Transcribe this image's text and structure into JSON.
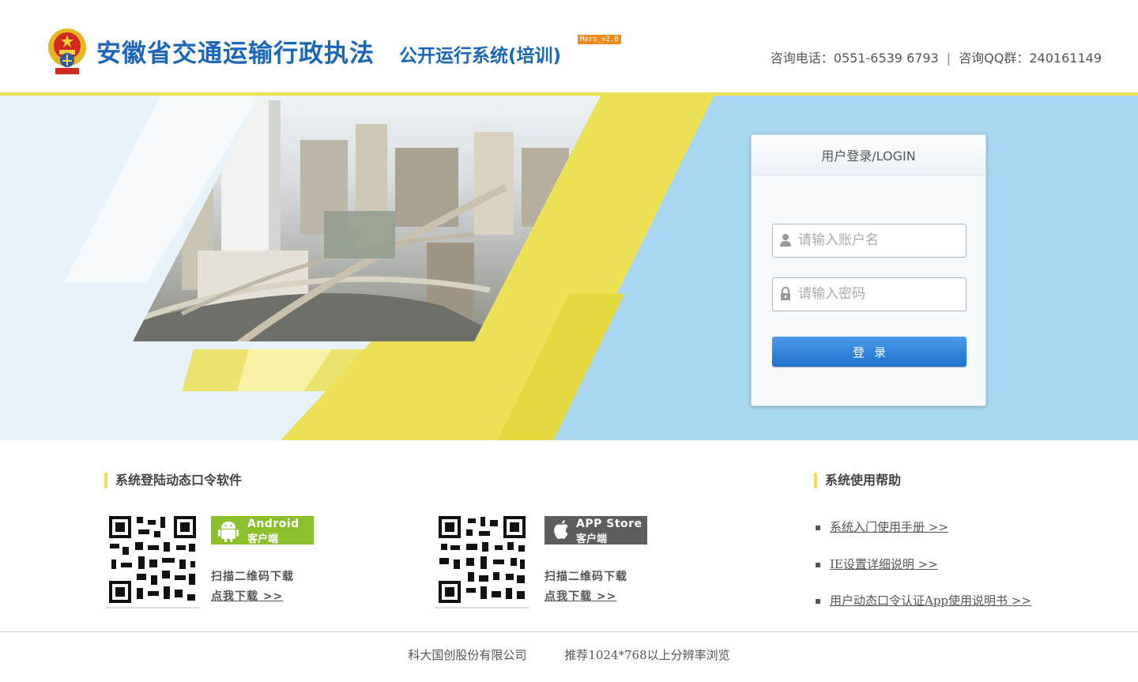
{
  "header": {
    "title_main": "安徽省交通运输行政执法",
    "title_sub": "公开运行系统(培训)",
    "version_badge": "Mars_v2.0",
    "phone_label": "咨询电话：",
    "phone": "0551-6539 6793",
    "separator": "|",
    "qq_label": "咨询QQ群：",
    "qq": "240161149"
  },
  "login": {
    "title": "用户登录/LOGIN",
    "username_placeholder": "请输入账户名",
    "password_placeholder": "请输入密码",
    "submit_label": "登录"
  },
  "downloads": {
    "section_title": "系统登陆动态口令软件",
    "android": {
      "badge_line1": "Android",
      "badge_line2": "客户端",
      "scan_text": "扫描二维码下载",
      "link_text": "点我下载 >>",
      "color": "#8bbf2c"
    },
    "ios": {
      "badge_line1": "APP Store",
      "badge_line2": "客户端",
      "scan_text": "扫描二维码下载",
      "link_text": "点我下载 >>",
      "color": "#5d5d5d"
    }
  },
  "help": {
    "section_title": "系统使用帮助",
    "items": [
      {
        "label": "系统入门使用手册 >>"
      },
      {
        "label": "IE设置详细说明 >>"
      },
      {
        "label": "用户动态口令认证App使用说明书 >>"
      }
    ]
  },
  "footer": {
    "company": "科大国创股份有限公司",
    "resolution": "推荐1024*768以上分辨率浏览"
  },
  "colors": {
    "brand_blue": "#1a66b8",
    "accent_yellow": "#ece155",
    "banner_blue": "#a9d6f0",
    "button_blue": "#2a7ad8"
  }
}
